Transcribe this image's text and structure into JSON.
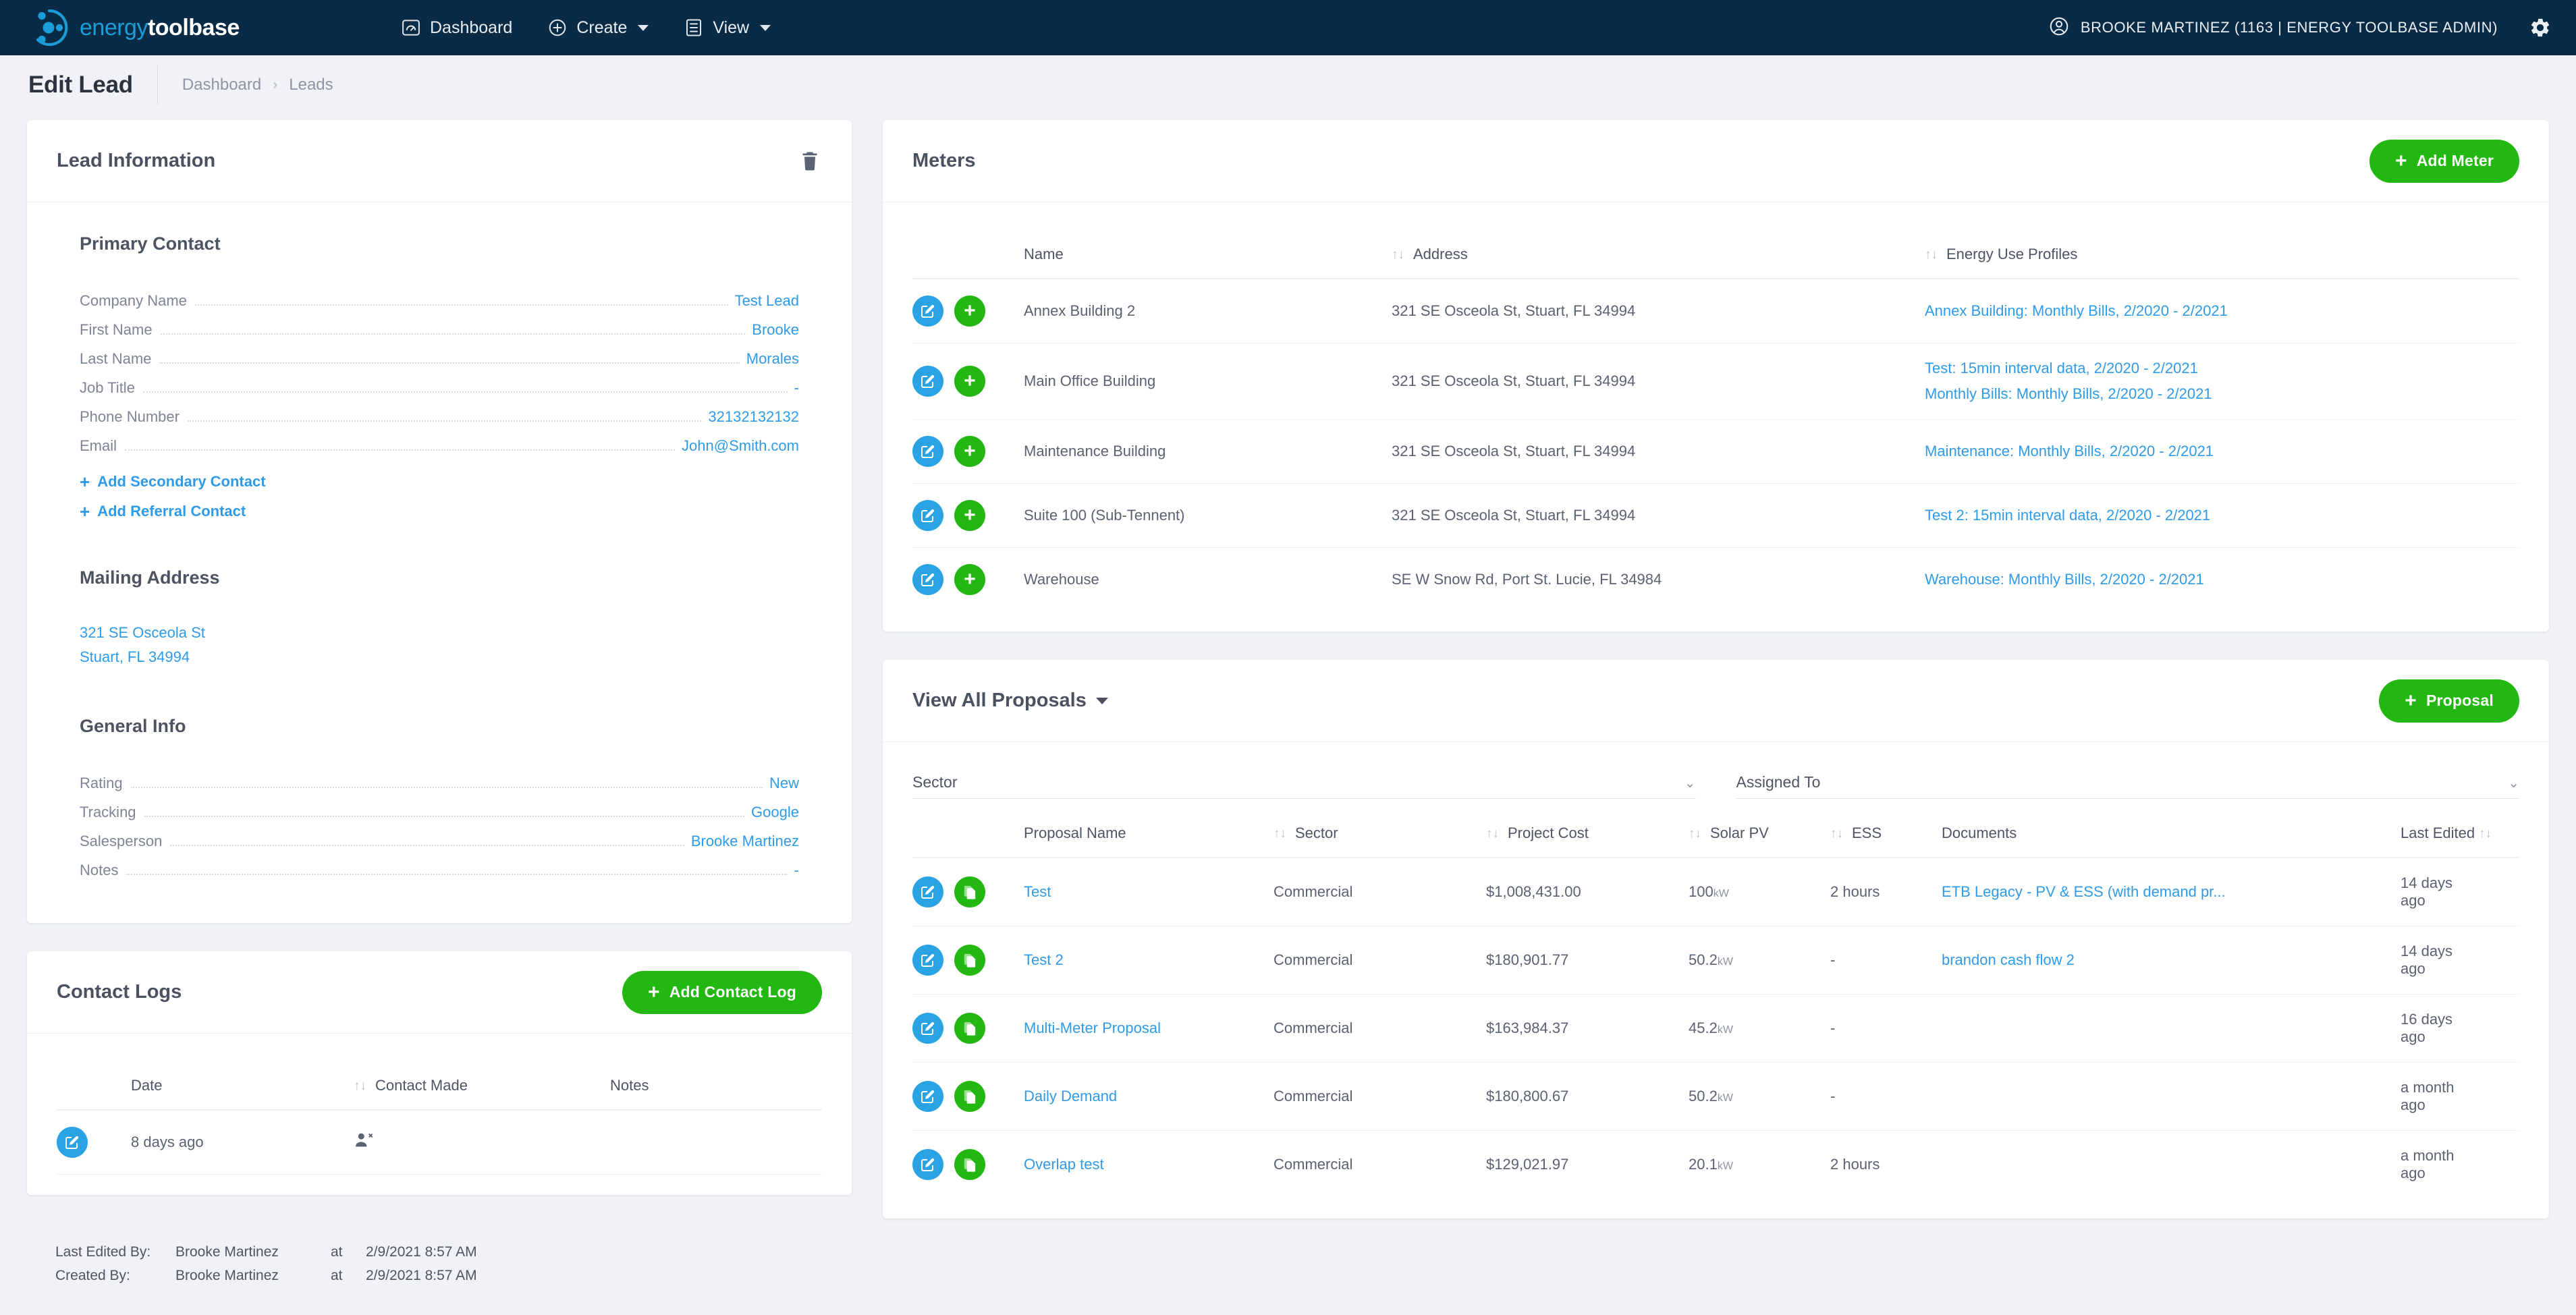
{
  "brand": {
    "name_part1": "energy",
    "name_part2": "toolbase",
    "logo_icon": "energy-toolbase-logo-icon",
    "accent_blue": "#1a9dd9",
    "nav_bg": "#0a2b45",
    "green": "#22b811",
    "link_blue": "#2f9be8"
  },
  "nav": {
    "items": [
      {
        "label": "Dashboard",
        "icon": "gauge-icon",
        "has_caret": false
      },
      {
        "label": "Create",
        "icon": "plus-circle-icon",
        "has_caret": true
      },
      {
        "label": "View",
        "icon": "list-icon",
        "has_caret": true
      }
    ],
    "user": "BROOKE MARTINEZ (1163 | ENERGY TOOLBASE ADMIN)",
    "user_icon": "user-circle-icon",
    "settings_icon": "gear-icon"
  },
  "page": {
    "title": "Edit Lead",
    "breadcrumbs": [
      "Dashboard",
      "Leads"
    ],
    "breadcrumb_separator": "›"
  },
  "lead_information": {
    "title": "Lead Information",
    "delete_icon": "trash-icon",
    "primary_contact": {
      "heading": "Primary Contact",
      "fields": [
        {
          "label": "Company Name",
          "value": "Test Lead"
        },
        {
          "label": "First Name",
          "value": "Brooke"
        },
        {
          "label": "Last Name",
          "value": "Morales"
        },
        {
          "label": "Job Title",
          "value": "-"
        },
        {
          "label": "Phone Number",
          "value": "32132132132"
        },
        {
          "label": "Email",
          "value": "John@Smith.com"
        }
      ],
      "add_secondary_contact": "Add Secondary Contact",
      "add_referral_contact": "Add Referral Contact"
    },
    "mailing_address": {
      "heading": "Mailing Address",
      "line1": "321 SE Osceola St",
      "line2": "Stuart, FL 34994"
    },
    "general_info": {
      "heading": "General Info",
      "fields": [
        {
          "label": "Rating",
          "value": "New"
        },
        {
          "label": "Tracking",
          "value": "Google"
        },
        {
          "label": "Salesperson",
          "value": "Brooke Martinez"
        },
        {
          "label": "Notes",
          "value": "-"
        }
      ]
    }
  },
  "contact_logs": {
    "title": "Contact Logs",
    "add_button": "Add Contact Log",
    "columns": [
      "Date",
      "Contact Made",
      "Notes"
    ],
    "rows": [
      {
        "edit_icon": "edit-icon",
        "date": "8 days ago",
        "contact_made_icon": "user-times-icon",
        "notes": ""
      }
    ]
  },
  "meters": {
    "title": "Meters",
    "add_button": "Add Meter",
    "columns": [
      "Name",
      "Address",
      "Energy Use Profiles"
    ],
    "rows": [
      {
        "name": "Annex Building 2",
        "address": "321 SE Osceola St, Stuart, FL 34994",
        "profiles": [
          "Annex Building:  Monthly Bills, 2/2020 - 2/2021"
        ]
      },
      {
        "name": "Main Office Building",
        "address": "321 SE Osceola St, Stuart, FL 34994",
        "profiles": [
          "Test:  15min interval data, 2/2020 - 2/2021",
          "Monthly Bills:  Monthly Bills, 2/2020 - 2/2021"
        ]
      },
      {
        "name": "Maintenance Building",
        "address": "321 SE Osceola St, Stuart, FL 34994",
        "profiles": [
          "Maintenance:  Monthly Bills, 2/2020 - 2/2021"
        ]
      },
      {
        "name": "Suite 100 (Sub-Tennent)",
        "address": "321 SE Osceola St, Stuart, FL 34994",
        "profiles": [
          "Test 2:  15min interval data, 2/2020 - 2/2021"
        ]
      },
      {
        "name": "Warehouse",
        "address": "SE W Snow Rd, Port St. Lucie, FL 34984",
        "profiles": [
          "Warehouse:  Monthly Bills, 2/2020 - 2/2021"
        ]
      }
    ]
  },
  "proposals": {
    "title": "View All Proposals",
    "add_button": "Proposal",
    "filters": [
      {
        "label": "Sector",
        "value": ""
      },
      {
        "label": "Assigned To",
        "value": ""
      }
    ],
    "columns": [
      "Proposal Name",
      "Sector",
      "Project Cost",
      "Solar PV",
      "ESS",
      "Documents",
      "Last Edited"
    ],
    "rows": [
      {
        "name": "Test",
        "sector": "Commercial",
        "project_cost": "$1,008,431.00",
        "solar_pv": "100",
        "solar_pv_unit": "kW",
        "ess": "2 hours",
        "documents": "ETB Legacy - PV & ESS (with demand pr...",
        "last_edited": "14 days ago"
      },
      {
        "name": "Test 2",
        "sector": "Commercial",
        "project_cost": "$180,901.77",
        "solar_pv": "50.2",
        "solar_pv_unit": "kW",
        "ess": "-",
        "documents": "brandon cash flow 2",
        "last_edited": "14 days ago"
      },
      {
        "name": "Multi-Meter Proposal",
        "sector": "Commercial",
        "project_cost": "$163,984.37",
        "solar_pv": "45.2",
        "solar_pv_unit": "kW",
        "ess": "-",
        "documents": "",
        "last_edited": "16 days ago"
      },
      {
        "name": "Daily Demand",
        "sector": "Commercial",
        "project_cost": "$180,800.67",
        "solar_pv": "50.2",
        "solar_pv_unit": "kW",
        "ess": "-",
        "documents": "",
        "last_edited": "a month ago"
      },
      {
        "name": "Overlap test",
        "sector": "Commercial",
        "project_cost": "$129,021.97",
        "solar_pv": "20.1",
        "solar_pv_unit": "kW",
        "ess": "2 hours",
        "documents": "",
        "last_edited": "a month ago"
      }
    ]
  },
  "footer": {
    "last_edited_label": "Last Edited By:",
    "last_edited_name": "Brooke Martinez",
    "last_edited_at": "at",
    "last_edited_time": "2/9/2021 8:57 AM",
    "created_label": "Created By:",
    "created_name": "Brooke Martinez",
    "created_at": "at",
    "created_time": "2/9/2021 8:57 AM"
  }
}
